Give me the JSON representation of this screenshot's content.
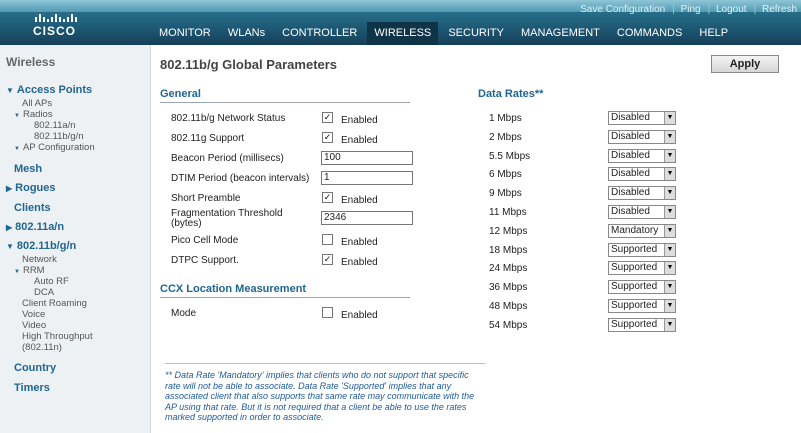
{
  "header": {
    "logo_text": "CISCO",
    "links": [
      "Save Configuration",
      "Ping",
      "Logout",
      "Refresh"
    ],
    "nav": [
      "MONITOR",
      "WLANs",
      "CONTROLLER",
      "WIRELESS",
      "SECURITY",
      "MANAGEMENT",
      "COMMANDS",
      "HELP"
    ],
    "active_nav": "WIRELESS"
  },
  "sidebar": {
    "title": "Wireless",
    "access_points": "Access Points",
    "all_aps": "All APs",
    "radios": "Radios",
    "radio_a": "802.11a/n",
    "radio_bg": "802.11b/g/n",
    "ap_config": "AP Configuration",
    "mesh": "Mesh",
    "rogues": "Rogues",
    "clients": "Clients",
    "a_n": "802.11a/n",
    "bg_n": "802.11b/g/n",
    "network": "Network",
    "rrm": "RRM",
    "auto_rf": "Auto RF",
    "dca": "DCA",
    "client_roaming": "Client Roaming",
    "voice": "Voice",
    "video": "Video",
    "ht1": "High Throughput",
    "ht2": "(802.11n)",
    "country": "Country",
    "timers": "Timers"
  },
  "main": {
    "title": "802.11b/g Global Parameters",
    "apply": "Apply",
    "general": {
      "heading": "General",
      "status_label": "802.11b/g Network Status",
      "status_text": "Enabled",
      "g_support_label": "802.11g Support",
      "g_support_text": "Enabled",
      "beacon_label": "Beacon Period (millisecs)",
      "beacon_value": "100",
      "dtim_label": "DTIM Period (beacon intervals)",
      "dtim_value": "1",
      "preamble_label": "Short Preamble",
      "preamble_text": "Enabled",
      "frag_label1": "Fragmentation Threshold",
      "frag_label2": "(bytes)",
      "frag_value": "2346",
      "pico_label": "Pico Cell Mode",
      "pico_text": "Enabled",
      "dtpc_label": "DTPC Support.",
      "dtpc_text": "Enabled"
    },
    "ccx": {
      "heading": "CCX Location Measurement",
      "mode_label": "Mode",
      "mode_text": "Enabled"
    },
    "data_rates": {
      "heading": "Data Rates**",
      "rates": [
        {
          "rate": "1 Mbps",
          "value": "Disabled"
        },
        {
          "rate": "2 Mbps",
          "value": "Disabled"
        },
        {
          "rate": "5.5 Mbps",
          "value": "Disabled"
        },
        {
          "rate": "6 Mbps",
          "value": "Disabled"
        },
        {
          "rate": "9 Mbps",
          "value": "Disabled"
        },
        {
          "rate": "11 Mbps",
          "value": "Disabled"
        },
        {
          "rate": "12 Mbps",
          "value": "Mandatory"
        },
        {
          "rate": "18 Mbps",
          "value": "Supported"
        },
        {
          "rate": "24 Mbps",
          "value": "Supported"
        },
        {
          "rate": "36 Mbps",
          "value": "Supported"
        },
        {
          "rate": "48 Mbps",
          "value": "Supported"
        },
        {
          "rate": "54 Mbps",
          "value": "Supported"
        }
      ]
    },
    "footnote": "** Data Rate 'Mandatory' implies that clients who do not support that specific rate will not be able to associate. Data Rate 'Supported' implies that any associated client that also supports that same rate may communicate with the AP using that rate. But it is not required that a client be able to use the rates marked supported in order to associate."
  }
}
